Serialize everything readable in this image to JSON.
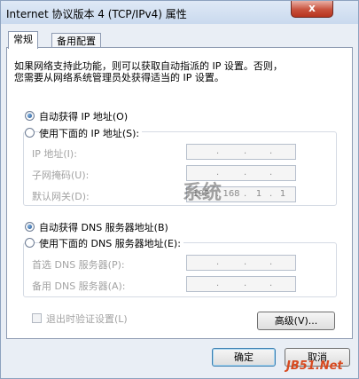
{
  "window": {
    "title": "Internet 协议版本 4 (TCP/IPv4) 属性",
    "close_label": "x"
  },
  "tabs": [
    {
      "label": "常规",
      "active": true
    },
    {
      "label": "备用配置",
      "active": false
    }
  ],
  "description": {
    "line1": "如果网络支持此功能，则可以获取自动指派的 IP 设置。否则，",
    "line2": "您需要从网络系统管理员处获得适当的 IP 设置。"
  },
  "ip": {
    "auto_label": "自动获得 IP 地址(O)",
    "auto_selected": true,
    "manual_label": "使用下面的 IP 地址(S):",
    "fields": [
      {
        "label": "IP 地址(I):",
        "value": [
          "",
          "",
          "",
          ""
        ]
      },
      {
        "label": "子网掩码(U):",
        "value": [
          "",
          "",
          "",
          ""
        ]
      },
      {
        "label": "默认网关(D):",
        "value": [
          "192",
          "168",
          "1",
          "1"
        ]
      }
    ]
  },
  "dns": {
    "auto_label": "自动获得 DNS 服务器地址(B)",
    "auto_selected": true,
    "manual_label": "使用下面的 DNS 服务器地址(E):",
    "fields": [
      {
        "label": "首选 DNS 服务器(P):",
        "value": [
          "",
          "",
          "",
          ""
        ]
      },
      {
        "label": "备用 DNS 服务器(A):",
        "value": [
          "",
          "",
          "",
          ""
        ]
      }
    ]
  },
  "validate": {
    "label": "退出时验证设置(L)",
    "checked": false
  },
  "buttons": {
    "advanced": "高级(V)...",
    "ok": "确定",
    "cancel": "取消"
  },
  "watermark": "系统",
  "logo": "JB51.Net"
}
